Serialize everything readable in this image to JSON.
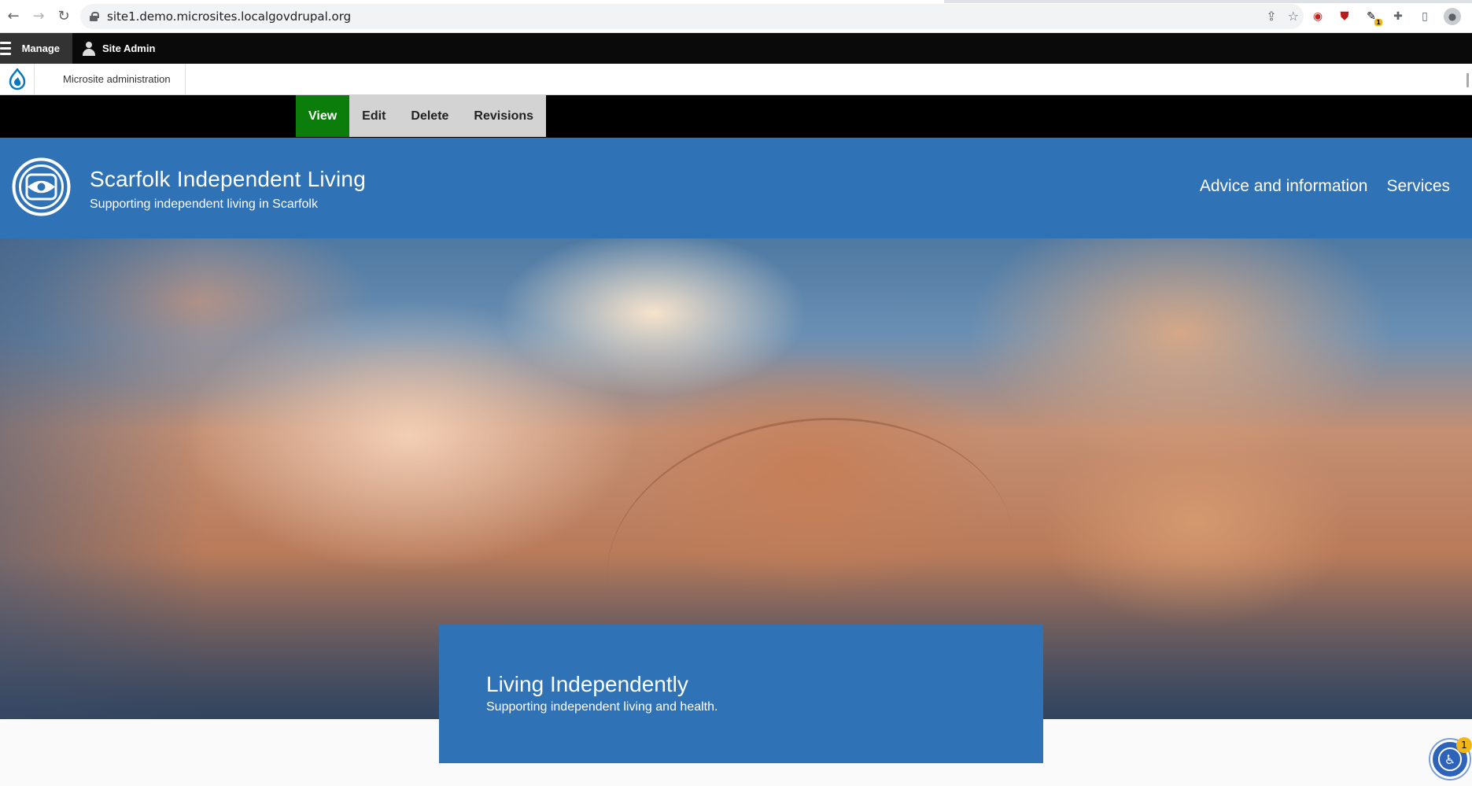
{
  "browser": {
    "url": "site1.demo.microsites.localgovdrupal.org"
  },
  "toolbar": {
    "manage_label": "Manage",
    "user_label": "Site Admin"
  },
  "subbar": {
    "admin_label": "Microsite administration"
  },
  "tasks": [
    {
      "label": "View",
      "active": true
    },
    {
      "label": "Edit",
      "active": false
    },
    {
      "label": "Delete",
      "active": false
    },
    {
      "label": "Revisions",
      "active": false
    }
  ],
  "site": {
    "title": "Scarfolk Independent Living",
    "slogan": "Supporting independent living in Scarfolk",
    "nav": [
      "Advice and information",
      "Services"
    ]
  },
  "hero": {
    "title": "Living Independently",
    "summary": "Supporting independent living and health."
  },
  "widgets": {
    "accessibility_badge": "1",
    "extension_badge": "1"
  },
  "colors": {
    "brand_blue": "#2f72b5",
    "active_tab": "#0a7d0a",
    "toolbar_bg": "#0a0a0a"
  }
}
